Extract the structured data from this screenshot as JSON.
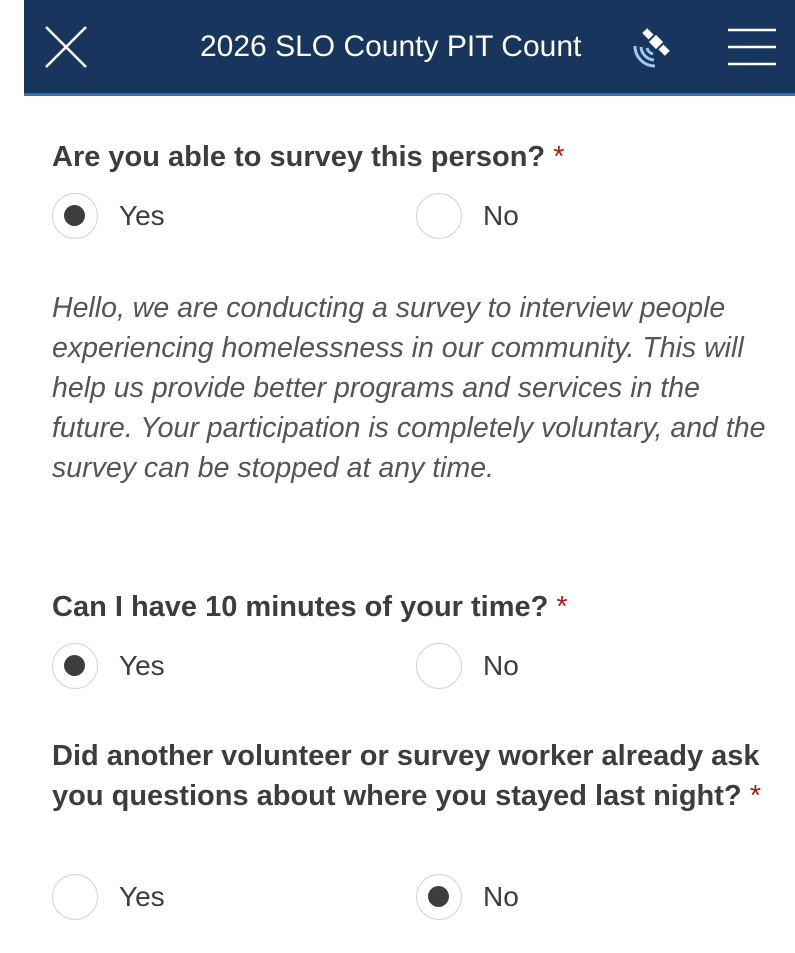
{
  "header": {
    "title": "2026 SLO County PIT Count",
    "close_icon": "close-icon",
    "gps_icon": "satellite-gps-icon",
    "menu_icon": "hamburger-menu-icon",
    "background_color": "#17355d"
  },
  "questions": [
    {
      "text": "Are you able to survey this person?",
      "required_mark": "*",
      "options": [
        {
          "label": "Yes",
          "selected": true
        },
        {
          "label": "No",
          "selected": false
        }
      ]
    },
    {
      "text": "Can I have 10 minutes of your time?",
      "required_mark": "*",
      "options": [
        {
          "label": "Yes",
          "selected": true
        },
        {
          "label": "No",
          "selected": false
        }
      ]
    },
    {
      "text": "Did another volunteer or survey worker already ask you questions about where you stayed last night?",
      "required_mark": "*",
      "options": [
        {
          "label": "Yes",
          "selected": false
        },
        {
          "label": "No",
          "selected": true
        }
      ]
    }
  ],
  "intro_text": "Hello, we are conducting a survey to interview people experiencing homelessness in our community. This will help us provide better programs and services in the future. Your participation is completely voluntary, and the survey can be stopped at any time.",
  "colors": {
    "required": "#b01919",
    "text": "#3d3d3d",
    "radio_border": "#d4d4d4"
  }
}
